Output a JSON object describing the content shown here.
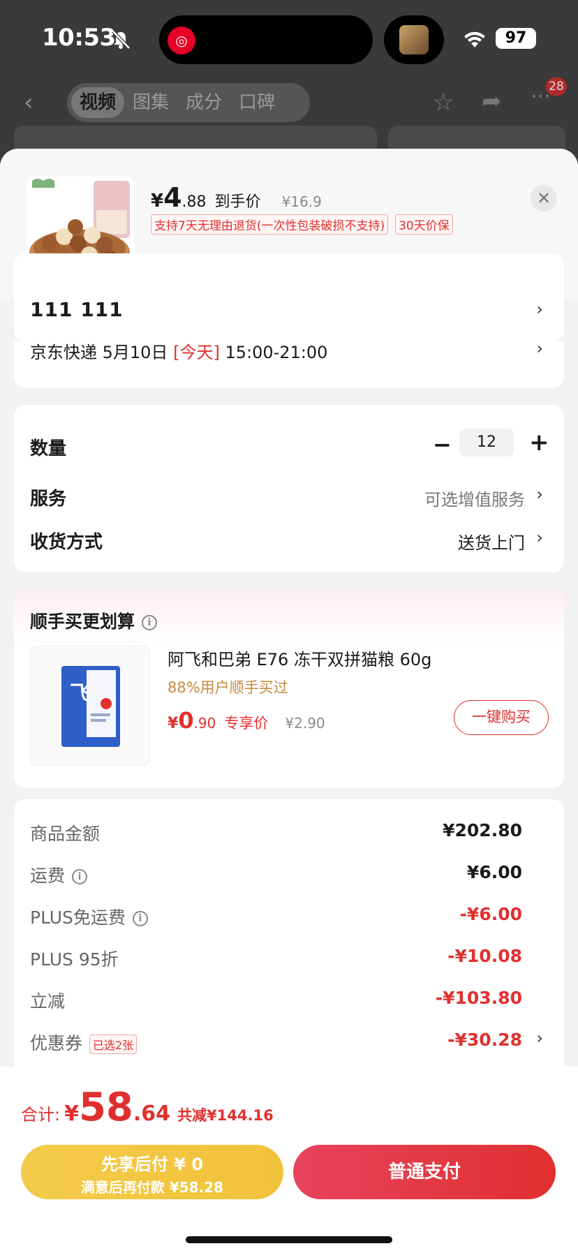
{
  "status_bar": {
    "time": "10:53",
    "battery": "97"
  },
  "nav": {
    "tabs": [
      "视频",
      "图集",
      "成分",
      "口碑"
    ],
    "active_tab": 0,
    "badge": "28"
  },
  "product": {
    "price_symbol": "¥",
    "price_int": "4",
    "price_dec": ".88",
    "price_label": "到手价",
    "original_price": "¥16.9",
    "tags": [
      "支持7天无理由退货(一次性包装破损不支持)",
      "30天价保"
    ]
  },
  "address": {
    "name": "111  111",
    "delivery_prefix": "京东快递 5月10日 ",
    "delivery_today": "[今天]",
    "delivery_time": " 15:00-21:00"
  },
  "options": {
    "quantity_label": "数量",
    "quantity_value": "12",
    "service_label": "服务",
    "service_value": "可选增值服务",
    "receive_label": "收货方式",
    "receive_value": "送货上门"
  },
  "recommend": {
    "title": "顺手买更划算",
    "name": "阿飞和巴弟 E76 冻干双拼猫粮 60g",
    "stat": "88%用户顺手买过",
    "price_symbol": "¥",
    "price_int": "0",
    "price_dec": ".90",
    "price_label": "专享价",
    "original_price": "¥2.90",
    "button": "一键购买"
  },
  "costs": [
    {
      "label": "商品金额",
      "value": "¥202.80"
    },
    {
      "label": "运费",
      "value": "¥6.00"
    },
    {
      "label": "PLUS免运费",
      "value": "-¥6.00"
    },
    {
      "label": "PLUS 95折",
      "value": "-¥10.08"
    },
    {
      "label": "立减",
      "value": "-¥103.80"
    },
    {
      "label": "优惠券",
      "value": "-¥30.28",
      "tag": "已选2张"
    }
  ],
  "bottom": {
    "total_label": "合计:",
    "total_symbol": "¥",
    "total_int": "58",
    "total_dec": ".64",
    "total_save": "共减¥144.16",
    "pay_later_line1": "先享后付 ¥ 0",
    "pay_later_line2": "满意后再付款 ¥58.28",
    "pay_normal": "普通支付"
  },
  "colors": {
    "accent": "#e0302e",
    "pay_later": "#f2c23a"
  },
  "icons": [
    "bell-muted-icon",
    "netease-music-icon",
    "wifi-icon",
    "back-icon",
    "star-icon",
    "share-icon",
    "more-icon",
    "close-icon",
    "chevron-right-icon",
    "info-icon",
    "minus-icon",
    "plus-icon"
  ]
}
